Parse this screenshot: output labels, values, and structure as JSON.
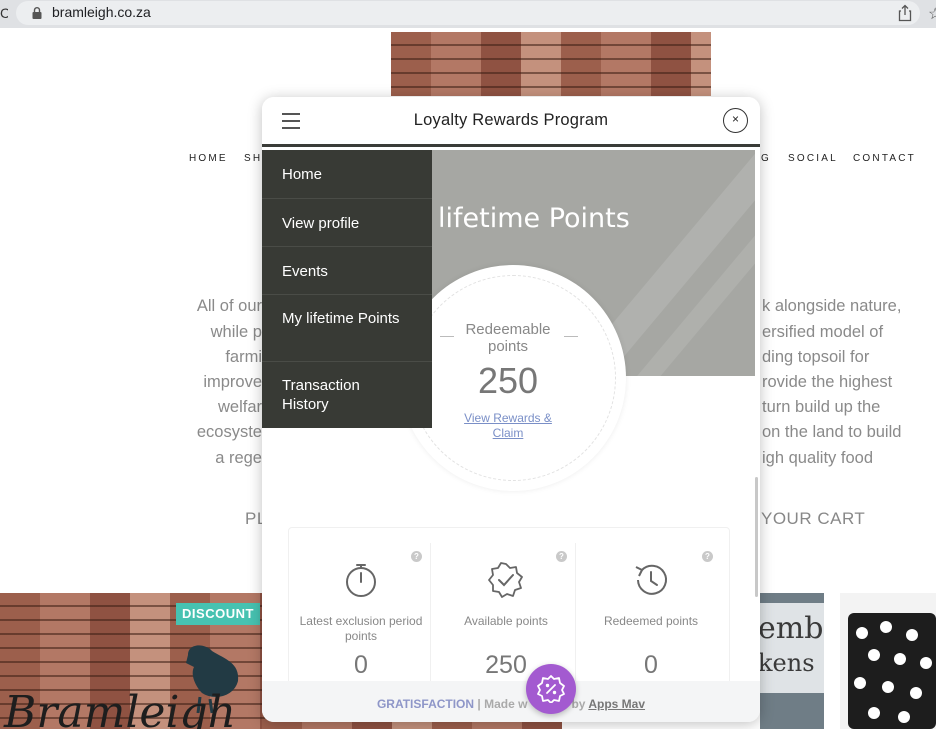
{
  "browser": {
    "url": "bramleigh.co.za"
  },
  "site": {
    "nav": [
      "HOME",
      "SH",
      "G",
      "SOCIAL",
      "CONTACT"
    ],
    "intro_left": [
      "All of our",
      "while p",
      "farmi",
      "improve",
      "welfar",
      "ecosyste",
      "a rege"
    ],
    "intro_right": [
      "k alongside nature,",
      "ersified model of",
      "ding topsoil for",
      "rovide the highest",
      "turn build up the",
      "on the land to build",
      "igh quality food"
    ],
    "cta_left": "PL",
    "cta_right": "YOUR CART",
    "discount_badge": "DISCOUNT",
    "colors": {
      "badge": "#47c2b1"
    }
  },
  "modal": {
    "title": "Loyalty Rewards Program",
    "close_label": "×",
    "hero_title": "lifetime Points",
    "menu": [
      "Home",
      "View profile",
      "Events",
      "My lifetime Points",
      "Transaction History"
    ],
    "redeemable": {
      "label": "Redeemable points",
      "value": "250",
      "link": "View Rewards & Claim"
    },
    "stats": [
      {
        "label": "Latest exclusion period points",
        "value": "0",
        "icon": "stopwatch-icon"
      },
      {
        "label": "Available points",
        "value": "250",
        "icon": "check-badge-icon"
      },
      {
        "label": "Redeemed points",
        "value": "0",
        "icon": "history-icon"
      }
    ],
    "help_glyph": "?",
    "footer": {
      "brand": "GRATISFACTION",
      "sep": " | Made w",
      "mid": "by ",
      "link": "Apps Mav"
    },
    "colors": {
      "menu": "#383a35",
      "hero": "#a6a7a3",
      "fab": "#a35ad0",
      "link": "#7a8fc7"
    }
  }
}
